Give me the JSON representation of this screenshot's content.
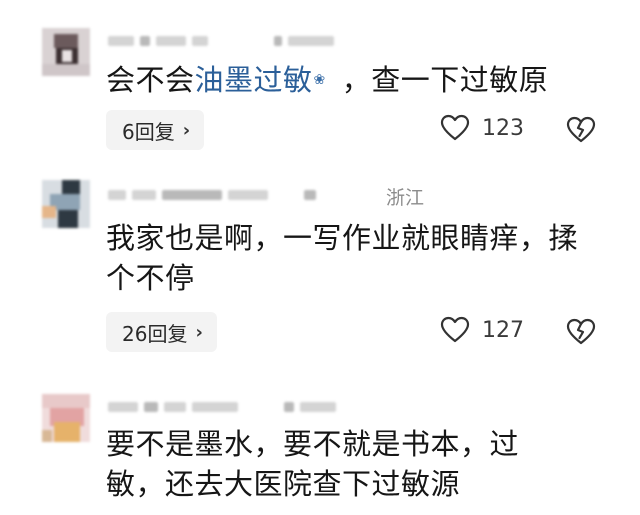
{
  "comments": [
    {
      "location": "",
      "text_before": "会不会",
      "link_text": "油墨过敏",
      "text_after": "，查一下过敏原",
      "reply_label": "6回复",
      "likes": "123",
      "avatar_colors": [
        "#cfc6c8",
        "#6b5a5c",
        "#3b2f31",
        "#e9e2e3"
      ]
    },
    {
      "location": "浙江",
      "text": "我家也是啊，一写作业就眼睛痒，揉个不停",
      "reply_label": "26回复",
      "likes": "127",
      "avatar_colors": [
        "#d8dde2",
        "#2e3942",
        "#8fa4b5",
        "#e5b68a"
      ]
    },
    {
      "location": "",
      "text": "要不是墨水，要不就是书本，过敏，还去大医院查下过敏源",
      "avatar_colors": [
        "#e8c9c9",
        "#e2a3a3",
        "#e6b26a",
        "#d8b896"
      ]
    }
  ],
  "icons": {
    "like": "heart-outline-icon",
    "dislike": "broken-heart-icon",
    "reply_chevron": "chevron-right-icon",
    "link": "search-link-icon"
  }
}
